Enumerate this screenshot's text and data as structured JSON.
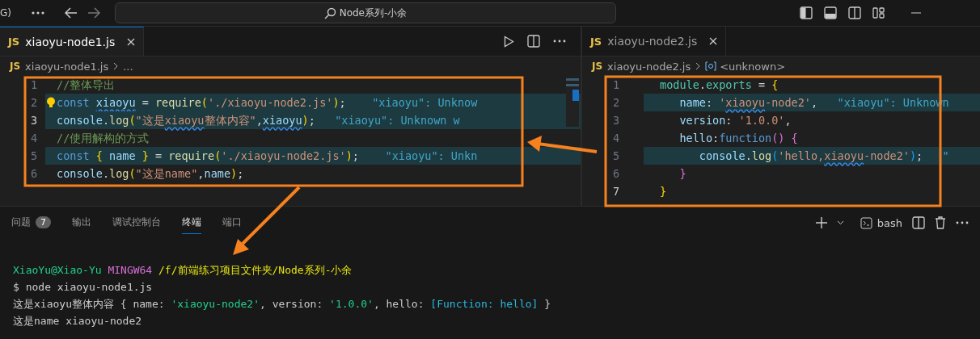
{
  "title_bar": {
    "menu_fragment": "G)",
    "search": "Node系列-小余"
  },
  "editors": [
    {
      "tab": {
        "badge": "JS",
        "label": "xiaoyu-node1.js",
        "selected": true
      },
      "breadcrumb": [
        {
          "kind": "file",
          "badge": "JS",
          "text": "xiaoyu-node1.js"
        },
        {
          "kind": "more",
          "text": "..."
        }
      ],
      "lines": [
        {
          "number": "1",
          "current": false,
          "highlighted": false,
          "tokens": [
            {
              "kind": "comment",
              "text": "//整体导出"
            }
          ]
        },
        {
          "number": "2",
          "current": false,
          "highlighted": true,
          "bulb": true,
          "tokens": [
            {
              "kind": "keyword",
              "text": "const "
            },
            {
              "kind": "var",
              "text": "xiaoyu",
              "warn": true
            },
            {
              "kind": "plain",
              "text": " = "
            },
            {
              "kind": "func",
              "text": "require"
            },
            {
              "kind": "bracket",
              "text": "("
            },
            {
              "kind": "string",
              "text": "'./xiaoyu-node2.js'"
            },
            {
              "kind": "bracket",
              "text": ")"
            },
            {
              "kind": "plain",
              "text": ";    "
            },
            {
              "kind": "hint",
              "text": "\"xiaoyu\": Unknow"
            }
          ]
        },
        {
          "number": "3",
          "current": true,
          "highlighted": true,
          "tokens": [
            {
              "kind": "var",
              "text": "console"
            },
            {
              "kind": "plain",
              "text": "."
            },
            {
              "kind": "func",
              "text": "log"
            },
            {
              "kind": "bracket",
              "text": "("
            },
            {
              "kind": "string",
              "text": "\"这是"
            },
            {
              "kind": "string",
              "text": "xiaoyu",
              "warn": true
            },
            {
              "kind": "string",
              "text": "整体内容\""
            },
            {
              "kind": "plain",
              "text": ","
            },
            {
              "kind": "var",
              "text": "xiaoyu",
              "warn": true
            },
            {
              "kind": "bracket",
              "text": ")"
            },
            {
              "kind": "plain",
              "text": ";   "
            },
            {
              "kind": "hint",
              "text": "\"xiaoyu\": Unknown w"
            }
          ]
        },
        {
          "number": "4",
          "current": false,
          "highlighted": false,
          "tokens": [
            {
              "kind": "comment",
              "text": "//使用解构的方式"
            }
          ]
        },
        {
          "number": "5",
          "current": false,
          "highlighted": true,
          "tokens": [
            {
              "kind": "keyword",
              "text": "const "
            },
            {
              "kind": "bracket",
              "text": "{"
            },
            {
              "kind": "var",
              "text": " name "
            },
            {
              "kind": "bracket",
              "text": "}"
            },
            {
              "kind": "plain",
              "text": " = "
            },
            {
              "kind": "func",
              "text": "require"
            },
            {
              "kind": "bracket",
              "text": "("
            },
            {
              "kind": "string",
              "text": "'./xiaoyu-node2.js'"
            },
            {
              "kind": "bracket",
              "text": ")"
            },
            {
              "kind": "plain",
              "text": ";    "
            },
            {
              "kind": "hint",
              "text": "\"xiaoyu\": Unkn"
            }
          ]
        },
        {
          "number": "6",
          "current": false,
          "highlighted": false,
          "tokens": [
            {
              "kind": "var",
              "text": "console"
            },
            {
              "kind": "plain",
              "text": "."
            },
            {
              "kind": "func",
              "text": "log"
            },
            {
              "kind": "bracket",
              "text": "("
            },
            {
              "kind": "string",
              "text": "\"这是name\""
            },
            {
              "kind": "plain",
              "text": ","
            },
            {
              "kind": "var",
              "text": "name"
            },
            {
              "kind": "bracket",
              "text": ")"
            },
            {
              "kind": "plain",
              "text": ";"
            }
          ]
        }
      ]
    },
    {
      "tab": {
        "badge": "JS",
        "label": "xiaoyu-node2.js",
        "selected": false
      },
      "breadcrumb": [
        {
          "kind": "file",
          "badge": "JS",
          "text": "xiaoyu-node2.js"
        },
        {
          "kind": "symbol",
          "text": "<unknown>"
        }
      ],
      "lines": [
        {
          "number": "1",
          "current": false,
          "highlighted": false,
          "tokens": [
            {
              "kind": "type",
              "text": "module"
            },
            {
              "kind": "plain",
              "text": "."
            },
            {
              "kind": "type",
              "text": "exports"
            },
            {
              "kind": "plain",
              "text": " = "
            },
            {
              "kind": "bracket",
              "text": "{"
            }
          ]
        },
        {
          "number": "2",
          "current": false,
          "highlighted": true,
          "tokens": [
            {
              "kind": "var",
              "text": "   name"
            },
            {
              "kind": "plain",
              "text": ": "
            },
            {
              "kind": "string",
              "text": "'"
            },
            {
              "kind": "string",
              "text": "xiaoyu",
              "warn": true
            },
            {
              "kind": "string",
              "text": "-node2'"
            },
            {
              "kind": "plain",
              "text": ",   "
            },
            {
              "kind": "hint",
              "text": "\"xiaoyu\": Unknown"
            }
          ]
        },
        {
          "number": "3",
          "current": false,
          "highlighted": false,
          "tokens": [
            {
              "kind": "var",
              "text": "   version"
            },
            {
              "kind": "plain",
              "text": ": "
            },
            {
              "kind": "string",
              "text": "'1.0.0'"
            },
            {
              "kind": "plain",
              "text": ","
            }
          ]
        },
        {
          "number": "4",
          "current": false,
          "highlighted": false,
          "tokens": [
            {
              "kind": "var",
              "text": "   hello"
            },
            {
              "kind": "plain",
              "text": ":"
            },
            {
              "kind": "keyword",
              "text": "function"
            },
            {
              "kind": "bracket2",
              "text": "()"
            },
            {
              "kind": "bracket2",
              "text": " {"
            }
          ]
        },
        {
          "number": "5",
          "current": false,
          "highlighted": true,
          "tokens": [
            {
              "kind": "var",
              "text": "      console"
            },
            {
              "kind": "plain",
              "text": "."
            },
            {
              "kind": "func",
              "text": "log"
            },
            {
              "kind": "bracket3",
              "text": "("
            },
            {
              "kind": "string",
              "text": "'hello,"
            },
            {
              "kind": "string",
              "text": "xiaoyu",
              "warn": true
            },
            {
              "kind": "string",
              "text": "-node2'"
            },
            {
              "kind": "bracket3",
              "text": ")"
            },
            {
              "kind": "plain",
              "text": ";   "
            },
            {
              "kind": "hint",
              "text": "\""
            }
          ]
        },
        {
          "number": "6",
          "current": false,
          "highlighted": false,
          "tokens": [
            {
              "kind": "bracket2",
              "text": "   }"
            }
          ]
        },
        {
          "number": "7",
          "current": true,
          "highlighted": false,
          "tokens": [
            {
              "kind": "bracket",
              "text": "}"
            }
          ]
        }
      ]
    }
  ],
  "panel": {
    "tabs": [
      {
        "label": "问题",
        "count": "7",
        "selected": false
      },
      {
        "label": "输出",
        "selected": false
      },
      {
        "label": "调试控制台",
        "selected": false
      },
      {
        "label": "终端",
        "selected": true
      },
      {
        "label": "端口",
        "selected": false
      }
    ],
    "shell": "bash"
  },
  "terminal": [
    [
      {
        "kind": "user",
        "text": "XiaoYu@Xiao-Yu "
      },
      {
        "kind": "host",
        "text": "MINGW64 "
      },
      {
        "kind": "path",
        "text": "/f/前端练习项目文件夹/Node系列-小余"
      }
    ],
    [
      {
        "kind": "plain",
        "text": "$ node xiaoyu-node1.js"
      }
    ],
    [
      {
        "kind": "plain",
        "text": "这是xiaoyu整体内容 { name: "
      },
      {
        "kind": "string",
        "text": "'xiaoyu-node2'"
      },
      {
        "kind": "plain",
        "text": ", version: "
      },
      {
        "kind": "string",
        "text": "'1.0.0'"
      },
      {
        "kind": "plain",
        "text": ", hello: "
      },
      {
        "kind": "func",
        "text": "[Function: hello]"
      },
      {
        "kind": "plain",
        "text": " }"
      }
    ],
    [
      {
        "kind": "plain",
        "text": "这是name xiaoyu-node2"
      }
    ]
  ]
}
